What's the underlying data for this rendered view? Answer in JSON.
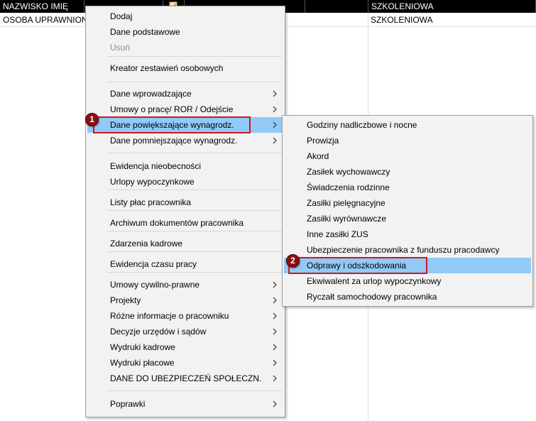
{
  "table": {
    "headers": [
      "NAZWISKO IMIĘ",
      "",
      "",
      "",
      "SZKOLENIOWA"
    ],
    "row": [
      "OSOBA UPRAWNIONA",
      "SZKOLENIOWA"
    ],
    "header_icon": "pencil-icon"
  },
  "context_menu": {
    "items": [
      {
        "label": "Dodaj",
        "disabled": false,
        "submenu": false
      },
      {
        "label": "Dane podstawowe",
        "disabled": false,
        "submenu": false
      },
      {
        "label": "Usuń",
        "disabled": true,
        "submenu": false
      },
      {
        "label": "Kreator zestawień osobowych",
        "disabled": false,
        "submenu": false
      },
      {
        "label": "Dane wprowadzające",
        "disabled": false,
        "submenu": true
      },
      {
        "label": "Umowy o pracę/ ROR / Odejście",
        "disabled": false,
        "submenu": true
      },
      {
        "label": "Dane powiększające wynagrodz.",
        "disabled": false,
        "submenu": true,
        "highlighted": true
      },
      {
        "label": "Dane pomniejszające wynagrodz.",
        "disabled": false,
        "submenu": true
      },
      {
        "label": "Ewidencja nieobecności",
        "disabled": false,
        "submenu": false
      },
      {
        "label": "Urlopy wypoczynkowe",
        "disabled": false,
        "submenu": false
      },
      {
        "label": "Listy płac pracownika",
        "disabled": false,
        "submenu": false
      },
      {
        "label": "Archiwum dokumentów pracownika",
        "disabled": false,
        "submenu": false
      },
      {
        "label": "Zdarzenia kadrowe",
        "disabled": false,
        "submenu": false
      },
      {
        "label": "Ewidencja czasu pracy",
        "disabled": false,
        "submenu": false
      },
      {
        "label": "Umowy cywilno-prawne",
        "disabled": false,
        "submenu": true
      },
      {
        "label": "Projekty",
        "disabled": false,
        "submenu": true
      },
      {
        "label": "Różne informacje o pracowniku",
        "disabled": false,
        "submenu": true
      },
      {
        "label": "Decyzje urzędów i sądów",
        "disabled": false,
        "submenu": true
      },
      {
        "label": "Wydruki kadrowe",
        "disabled": false,
        "submenu": true
      },
      {
        "label": "Wydruki płacowe",
        "disabled": false,
        "submenu": true
      },
      {
        "label": "DANE DO UBEZPIECZEŃ SPOŁECZN.",
        "disabled": false,
        "submenu": true
      },
      {
        "label": "Poprawki",
        "disabled": false,
        "submenu": true
      }
    ]
  },
  "submenu": {
    "items": [
      {
        "label": "Godziny nadliczbowe i nocne"
      },
      {
        "label": "Prowizja"
      },
      {
        "label": "Akord"
      },
      {
        "label": "Zasiłek wychowawczy"
      },
      {
        "label": "Świadczenia rodzinne"
      },
      {
        "label": "Zasiłki pielęgnacyjne"
      },
      {
        "label": "Zasiłki wyrównawcze"
      },
      {
        "label": "Inne zasiłki ZUS"
      },
      {
        "label": "Ubezpieczenie pracownika z funduszu pracodawcy"
      },
      {
        "label": "Odprawy i odszkodowania",
        "highlighted": true
      },
      {
        "label": "Ekwiwalent za urlop wypoczynkowy"
      },
      {
        "label": "Ryczałt samochodowy pracownika"
      }
    ]
  },
  "annotations": {
    "step1": "1",
    "step2": "2"
  },
  "colors": {
    "highlight": "#91c9f7",
    "callout": "#d0161f",
    "badge": "#8b0d13"
  }
}
